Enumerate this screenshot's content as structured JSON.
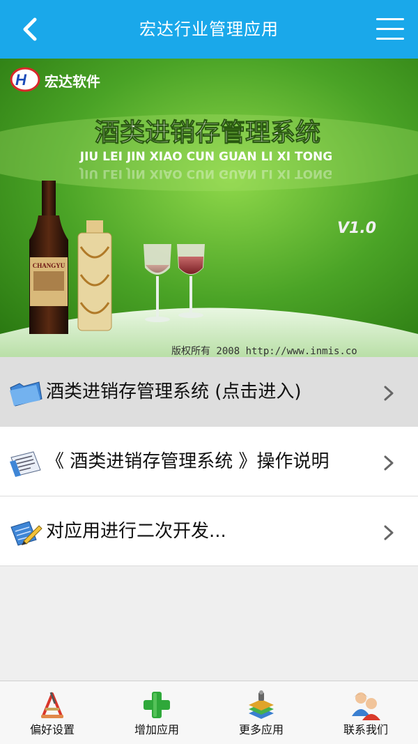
{
  "header": {
    "title": "宏达行业管理应用",
    "back_icon": "back-arrow-icon",
    "menu_icon": "hamburger-menu-icon",
    "bg_color": "#1aa8ea"
  },
  "banner": {
    "logo_text": "宏达软件",
    "headline": "酒类进销存管理系统",
    "pinyin": "JIU LEI JIN XIAO CUN GUAN LI XI TONG",
    "version": "V1.0",
    "footer": "版权所有 2008 http://www.inmis.co",
    "bottle_label": "CHANGYU"
  },
  "list": {
    "items": [
      {
        "label": "酒类进销存管理系统 (点击进入)",
        "icon": "folder-icon"
      },
      {
        "label": "《 酒类进销存管理系统 》操作说明",
        "icon": "document-icon"
      },
      {
        "label": "对应用进行二次开发...",
        "icon": "develop-pencil-icon"
      }
    ]
  },
  "tabbar": {
    "tabs": [
      {
        "label": "偏好设置",
        "icon": "preferences-icon"
      },
      {
        "label": "增加应用",
        "icon": "add-plus-icon"
      },
      {
        "label": "更多应用",
        "icon": "more-apps-icon"
      },
      {
        "label": "联系我们",
        "icon": "contacts-icon"
      }
    ]
  }
}
